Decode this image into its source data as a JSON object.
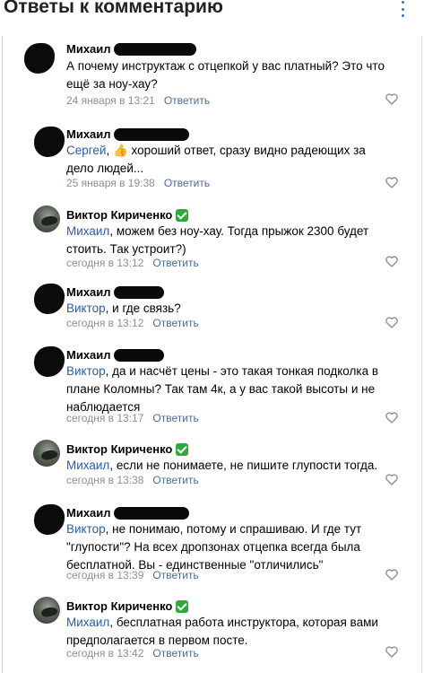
{
  "header": {
    "title": "Ответы к комментарию"
  },
  "comments": [
    {
      "author": "Михаил",
      "mention": "",
      "body": "А почему инструктаж с отцепкой у вас платный? Это что ещё за ноу-хау?",
      "time": "24 января в 13:21",
      "reply": "Ответить"
    },
    {
      "author": "Михаил",
      "mention": "Сергей",
      "body": ", 👍 хороший ответ, сразу видно радеющих за дело людей...",
      "time": "25 января в 19:38",
      "reply": "Ответить"
    },
    {
      "author": "Виктор Кириченко",
      "mention": "Михаил",
      "body": ", можем без ноу-хау. Тогда прыжок 2300 будет стоить. Так устроит?)",
      "time": "сегодня в 13:12",
      "reply": "Ответить"
    },
    {
      "author": "Михаил",
      "mention": "Виктор",
      "body": ", и где связь?",
      "time": "сегодня в 13:12",
      "reply": "Ответить"
    },
    {
      "author": "Михаил",
      "mention": "Виктор",
      "body": ", да и насчёт цены - это такая тонкая подколка в плане Коломны? Так там 4к, а у вас такой высоты и не наблюдается",
      "time": "сегодня в 13:17",
      "reply": "Ответить"
    },
    {
      "author": "Виктор Кириченко",
      "mention": "Михаил",
      "body": ", если не понимаете, не пишите глупости тогда.",
      "time": "сегодня в 13:38",
      "reply": "Ответить"
    },
    {
      "author": "Михаил",
      "mention": "Виктор",
      "body": ", не понимаю, потому и спрашиваю. И где тут \"глупости\"? На всех дропзонах отцепка всегда была бесплатной. Вы - единственные \"отличились\"",
      "time": "сегодня в 13:39",
      "reply": "Ответить"
    },
    {
      "author": "Виктор Кириченко",
      "mention": "Михаил",
      "body": ", бесплатная работа инструктора, которая вами предполагается в первом посте.",
      "time": "сегодня в 13:42",
      "reply": "Ответить"
    }
  ],
  "icons": {
    "heart": "heart-outline-icon",
    "verified": "verified-check-icon",
    "menu": "more-vertical-icon"
  },
  "colors": {
    "mention": "#2a5ab8",
    "meta": "#8a8f96",
    "reply": "#4c6c96",
    "verified": "#2faa3a",
    "menu": "#3f72c7"
  }
}
